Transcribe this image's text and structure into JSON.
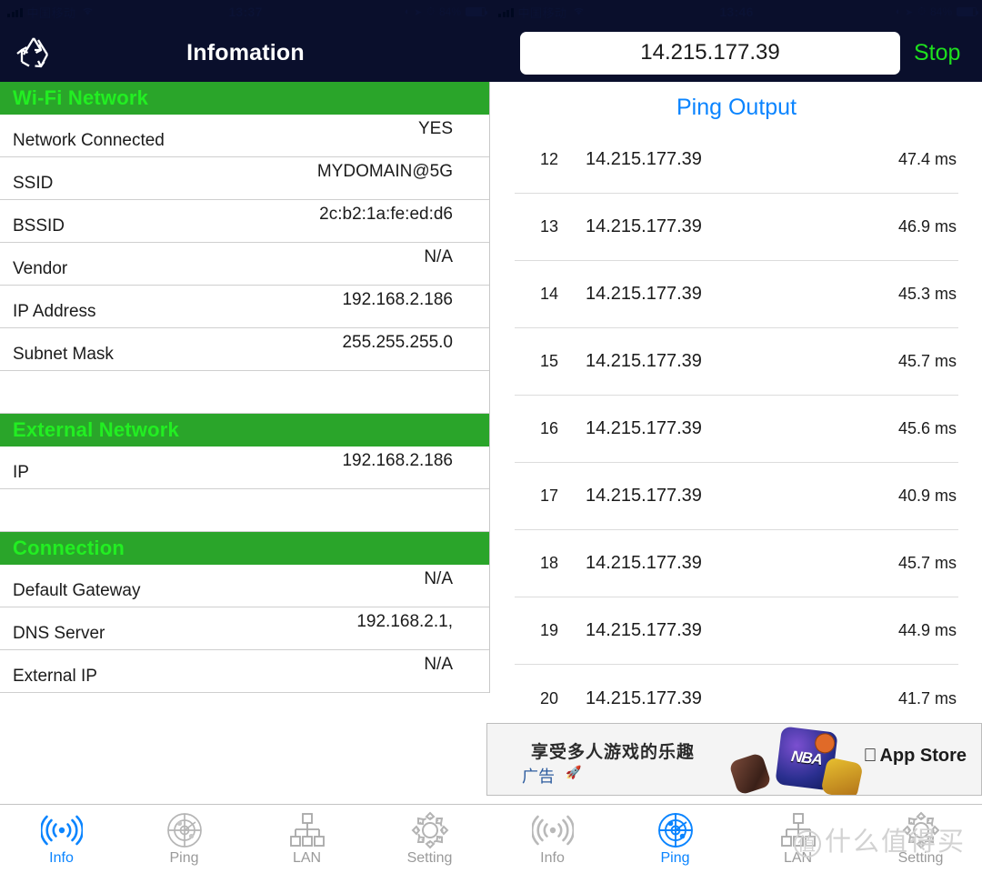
{
  "colors": {
    "navy": "#0a0f2c",
    "section_green_bg": "#2aa52a",
    "section_green_text": "#22ee22",
    "accent_blue": "#0a84ff",
    "stop_green": "#1ee01e",
    "inactive_gray": "#9a9a9a"
  },
  "left": {
    "statusbar": {
      "carrier": "中国移动",
      "time": "13:37",
      "battery_text": "84%",
      "battery_level": 84,
      "wifi_icon": "wifi-icon",
      "signal_icon": "signal-bars-icon",
      "lock_icon": "rotation-lock-icon",
      "location_icon": "location-arrow-icon",
      "alarm_icon": "alarm-clock-icon"
    },
    "navbar": {
      "title": "Infomation",
      "refresh_icon": "recycle-refresh-icon"
    },
    "sections": [
      {
        "title": "Wi-Fi Network",
        "rows": [
          {
            "key": "Network Connected",
            "value": "YES"
          },
          {
            "key": "SSID",
            "value": "MYDOMAIN@5G"
          },
          {
            "key": "BSSID",
            "value": "2c:b2:1a:fe:ed:d6"
          },
          {
            "key": "Vendor",
            "value": "N/A"
          },
          {
            "key": "IP Address",
            "value": "192.168.2.186"
          },
          {
            "key": "Subnet Mask",
            "value": "255.255.255.0"
          },
          {
            "key": "",
            "value": ""
          }
        ]
      },
      {
        "title": "External Network",
        "rows": [
          {
            "key": "IP",
            "value": "192.168.2.186"
          },
          {
            "key": "",
            "value": ""
          }
        ]
      },
      {
        "title": "Connection",
        "rows": [
          {
            "key": "Default Gateway",
            "value": "N/A"
          },
          {
            "key": "DNS Server",
            "value": "192.168.2.1,"
          },
          {
            "key": "External IP",
            "value": "N/A"
          }
        ]
      }
    ],
    "tabs": [
      {
        "label": "Info",
        "icon": "wifi-signal-icon",
        "active": true
      },
      {
        "label": "Ping",
        "icon": "radar-icon",
        "active": false
      },
      {
        "label": "LAN",
        "icon": "network-tree-icon",
        "active": false
      },
      {
        "label": "Setting",
        "icon": "gear-icon",
        "active": false
      }
    ]
  },
  "right": {
    "statusbar": {
      "carrier": "中国移动",
      "time": "13:46",
      "battery_text": "84%",
      "battery_level": 84,
      "wifi_icon": "wifi-icon",
      "signal_icon": "signal-bars-icon",
      "lock_icon": "rotation-lock-icon",
      "location_icon": "location-arrow-icon",
      "alarm_icon": "alarm-clock-icon"
    },
    "navbar": {
      "host_value": "14.215.177.39",
      "host_placeholder": "14.215.177.39",
      "stop_label": "Stop"
    },
    "ping": {
      "title": "Ping Output",
      "unit": "ms",
      "rows": [
        {
          "index": "12",
          "host": "14.215.177.39",
          "latency": "47.4 ms"
        },
        {
          "index": "13",
          "host": "14.215.177.39",
          "latency": "46.9 ms"
        },
        {
          "index": "14",
          "host": "14.215.177.39",
          "latency": "45.3 ms"
        },
        {
          "index": "15",
          "host": "14.215.177.39",
          "latency": "45.7 ms"
        },
        {
          "index": "16",
          "host": "14.215.177.39",
          "latency": "45.6 ms"
        },
        {
          "index": "17",
          "host": "14.215.177.39",
          "latency": "40.9 ms"
        },
        {
          "index": "18",
          "host": "14.215.177.39",
          "latency": "45.7 ms"
        },
        {
          "index": "19",
          "host": "14.215.177.39",
          "latency": "44.9 ms"
        },
        {
          "index": "20",
          "host": "14.215.177.39",
          "latency": "41.7 ms"
        }
      ]
    },
    "ad": {
      "headline": "享受多人游戏的乐趣",
      "label": "广告",
      "rocket_icon": "rocket-icon",
      "store_label": "App Store",
      "apple_icon": "apple-logo-icon",
      "game_badge": "NBA"
    },
    "tabs": [
      {
        "label": "Info",
        "icon": "wifi-signal-icon",
        "active": false
      },
      {
        "label": "Ping",
        "icon": "radar-icon",
        "active": true
      },
      {
        "label": "LAN",
        "icon": "network-tree-icon",
        "active": false
      },
      {
        "label": "Setting",
        "icon": "gear-icon",
        "active": false
      }
    ],
    "watermark": {
      "mark": "值",
      "text": "什么值得买"
    }
  }
}
